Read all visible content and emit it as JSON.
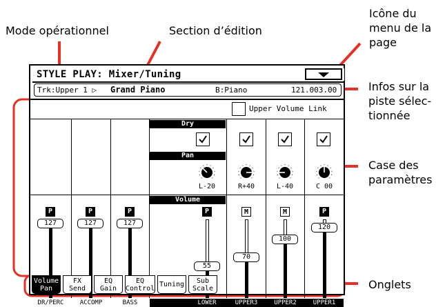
{
  "callouts": {
    "mode": "Mode opérationnel",
    "section": "Section d’édition",
    "menu_icon": [
      "Icône du",
      "menu de la",
      "page"
    ],
    "track_info": [
      "Infos sur la",
      "piste sélec-",
      "tionnée"
    ],
    "param_box": [
      "Case des",
      "paramètres"
    ],
    "tabs": "Onglets"
  },
  "screen": {
    "title": "STYLE PLAY: Mixer/Tuning",
    "track": {
      "name": "Trk:Upper 1 ▷",
      "sound": "Grand Piano",
      "bank": "B:Piano",
      "program": "121.003.00"
    },
    "upper_volume_link": "Upper Volume Link",
    "section_labels": {
      "dry": "Dry",
      "pan": "Pan",
      "volume": "Volume"
    },
    "pan_values": [
      "L-20",
      "R+40",
      "L-40",
      "C 00"
    ],
    "pan_knob_degrees": [
      -45,
      90,
      -90,
      0
    ],
    "volumes": [
      {
        "badge": "P",
        "value": "127",
        "level": 1.0
      },
      {
        "badge": "P",
        "value": "127",
        "level": 1.0
      },
      {
        "badge": "P",
        "value": "127",
        "level": 1.0
      },
      {
        "badge": "P",
        "value": "55",
        "level": 0.43
      },
      {
        "badge": "M",
        "value": "70",
        "level": 0.55
      },
      {
        "badge": "M",
        "value": "100",
        "level": 0.79
      },
      {
        "badge": "P",
        "value": "120",
        "level": 0.94
      }
    ],
    "channels": [
      "DR/PERC",
      "ACCOMP",
      "BASS",
      "LOWER",
      "UPPER3",
      "UPPER2",
      "UPPER1"
    ],
    "tabs": [
      [
        "Volume",
        "Pan"
      ],
      [
        "FX",
        "Send"
      ],
      [
        "EQ",
        "Gain"
      ],
      [
        "EQ",
        "Control"
      ],
      [
        "Tuning"
      ],
      [
        "Sub",
        "Scale"
      ]
    ],
    "active_tab": 0
  },
  "colors": {
    "callout_line": "#e53027",
    "screen_fg": "#000000",
    "screen_bg": "#ffffff"
  }
}
